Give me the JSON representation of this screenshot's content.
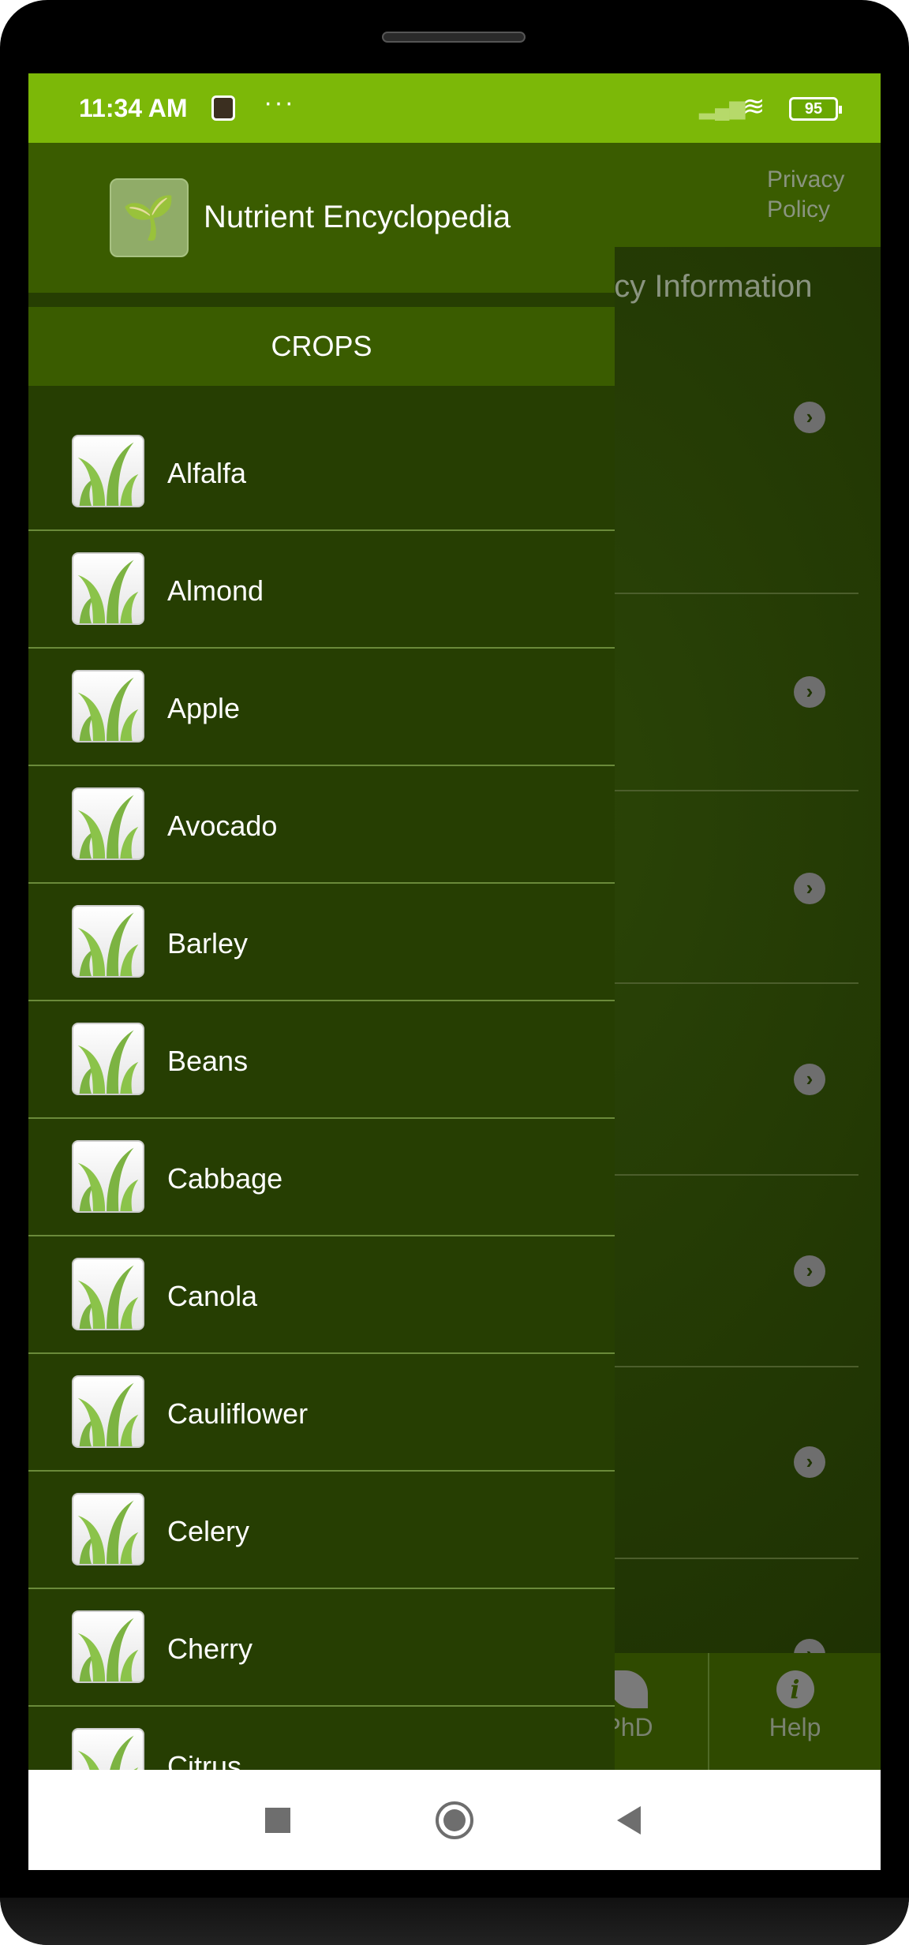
{
  "status_bar": {
    "time": "11:34 AM",
    "dots": "···",
    "battery": "95",
    "color": "#7cb808"
  },
  "background_app": {
    "toolbar_link": "Privacy Policy",
    "section_title": "ncy Information",
    "tabs": [
      {
        "label": "PhD",
        "icon": "leaf-icon"
      },
      {
        "label": "Help",
        "icon": "info-icon"
      }
    ]
  },
  "drawer": {
    "app_title": "Nutrient Encyclopedia",
    "section": "CROPS",
    "items": [
      {
        "label": "Alfalfa"
      },
      {
        "label": "Almond"
      },
      {
        "label": "Apple"
      },
      {
        "label": "Avocado"
      },
      {
        "label": "Barley"
      },
      {
        "label": "Beans"
      },
      {
        "label": "Cabbage"
      },
      {
        "label": "Canola"
      },
      {
        "label": "Cauliflower"
      },
      {
        "label": "Celery"
      },
      {
        "label": "Cherry"
      },
      {
        "label": "Citrus"
      }
    ]
  }
}
